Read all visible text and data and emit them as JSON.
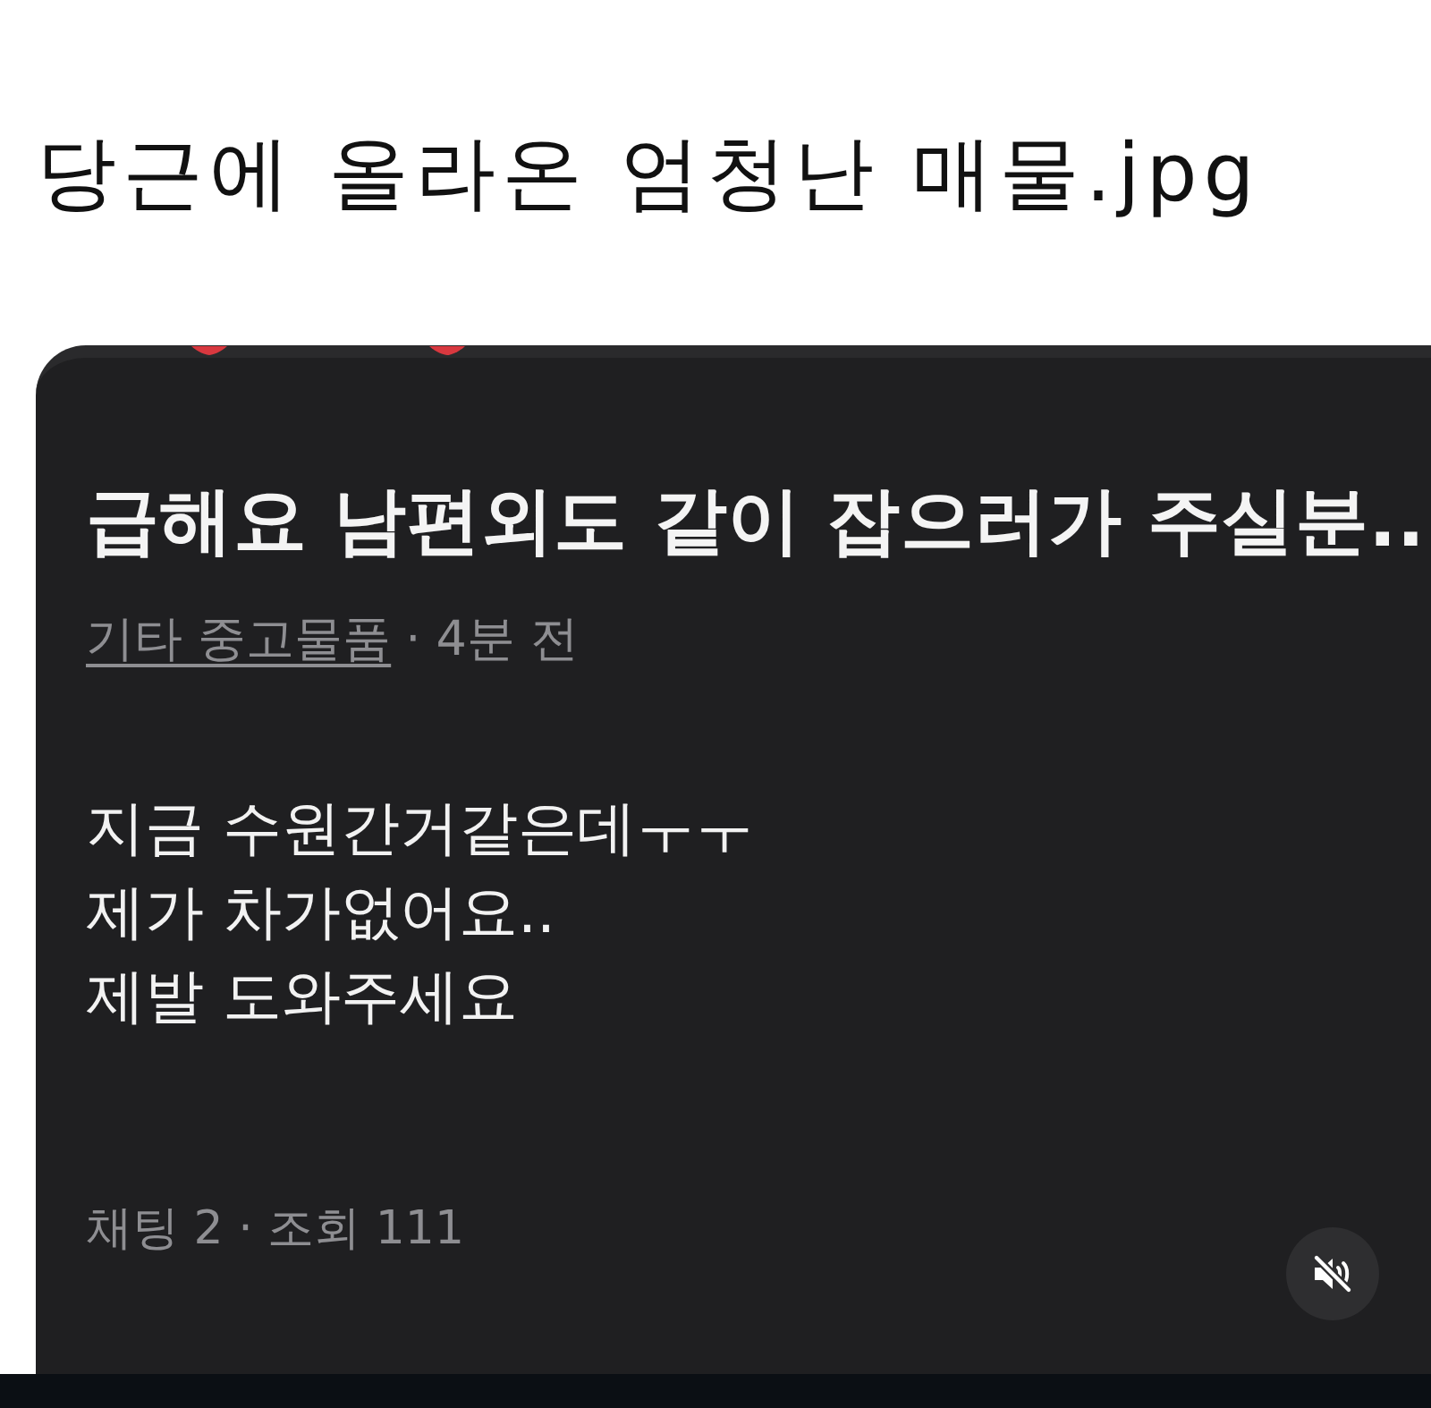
{
  "page": {
    "title": "당근에 올라온 엄청난 매물.jpg"
  },
  "listing": {
    "title": "급해요 남편외도 같이 잡으러가 주실분..",
    "category": "기타 중고물품",
    "time": "· 4분 전",
    "body": [
      "지금 수원간거같은데ㅜㅜ",
      "제가 차가없어요..",
      "제발 도와주세요"
    ],
    "stats": "채팅 2 · 조회 111"
  },
  "video": {
    "muted": true
  }
}
